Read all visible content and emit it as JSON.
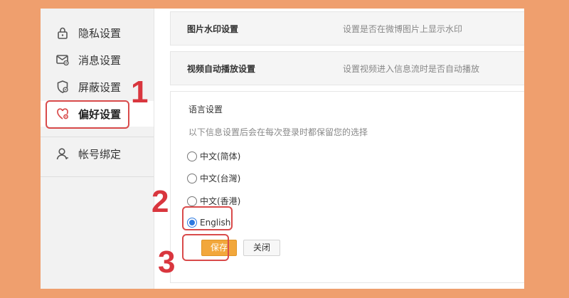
{
  "sidebar": {
    "items": [
      {
        "label": "隐私设置",
        "icon": "lock-icon"
      },
      {
        "label": "消息设置",
        "icon": "message-icon"
      },
      {
        "label": "屏蔽设置",
        "icon": "shield-icon"
      },
      {
        "label": "偏好设置",
        "icon": "heart-gear-icon",
        "active": true
      },
      {
        "label": "帐号绑定",
        "icon": "user-icon"
      }
    ]
  },
  "settings": {
    "watermark": {
      "title": "图片水印设置",
      "desc": "设置是否在微博图片上显示水印"
    },
    "autoplay": {
      "title": "视频自动播放设置",
      "desc": "设置视频进入信息流时是否自动播放"
    }
  },
  "language": {
    "title": "语言设置",
    "desc": "以下信息设置后会在每次登录时都保留您的选择",
    "options": [
      {
        "label": "中文(简体)",
        "checked": false
      },
      {
        "label": "中文(台灣)",
        "checked": false
      },
      {
        "label": "中文(香港)",
        "checked": false
      },
      {
        "label": "English",
        "checked": true
      }
    ],
    "save_label": "保存",
    "close_label": "关闭"
  },
  "annotations": {
    "step1": "1",
    "step2": "2",
    "step3": "3",
    "color": "#d9363e"
  },
  "colors": {
    "background": "#ef9f6e",
    "save_button": "#f2a73b",
    "radio_checked": "#2d7ae0"
  }
}
